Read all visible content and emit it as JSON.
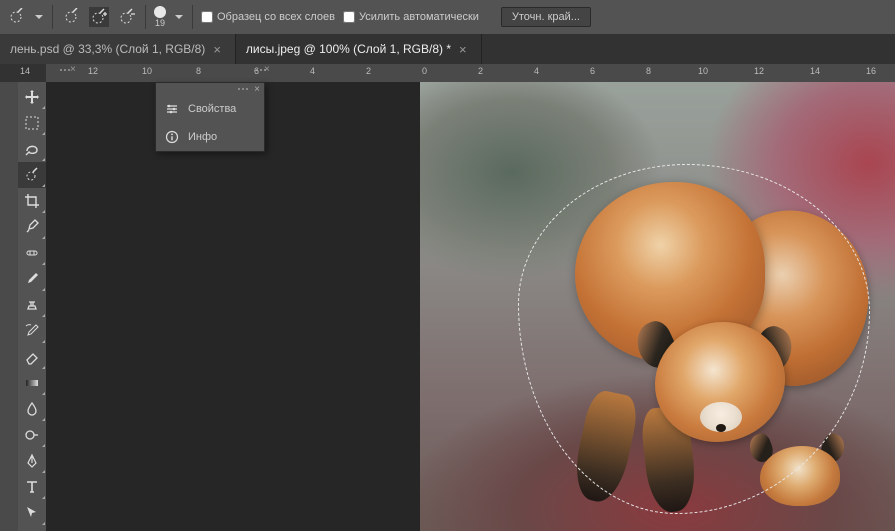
{
  "options": {
    "brush_size": "19",
    "sample_all_layers_label": "Образец со всех слоев",
    "auto_enhance_label": "Усилить автоматически",
    "refine_edge_label": "Уточн. край..."
  },
  "tabs": [
    {
      "label": "лень.psd @ 33,3% (Слой 1, RGB/8)",
      "active": false
    },
    {
      "label": "лисы.jpeg @ 100% (Слой 1, RGB/8) *",
      "active": true
    }
  ],
  "ruler": {
    "marks": [
      "14",
      "12",
      "10",
      "8",
      "6",
      "4",
      "2",
      "0",
      "2",
      "4",
      "6",
      "8",
      "10",
      "12",
      "14",
      "16"
    ]
  },
  "panel": {
    "items": [
      {
        "icon": "properties",
        "label": "Свойства"
      },
      {
        "icon": "info",
        "label": "Инфо"
      }
    ]
  },
  "tools": [
    "move",
    "marquee",
    "lasso",
    "quick-select",
    "crop",
    "eyedropper",
    "healing",
    "brush",
    "stamp",
    "history-brush",
    "eraser",
    "gradient",
    "blur",
    "dodge",
    "pen",
    "type",
    "path-select"
  ],
  "active_tool": "quick-select"
}
